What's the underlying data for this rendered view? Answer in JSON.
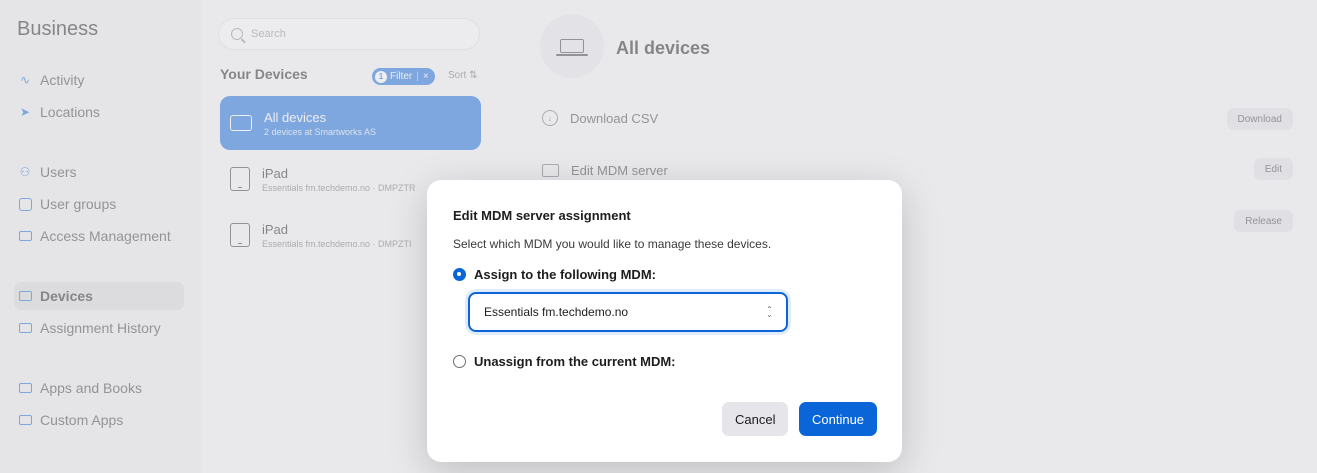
{
  "sidebar": {
    "brand": "Business",
    "items": [
      {
        "label": "Activity"
      },
      {
        "label": "Locations"
      },
      {
        "label": "Users"
      },
      {
        "label": "User groups"
      },
      {
        "label": "Access Management"
      },
      {
        "label": "Devices",
        "selected": true
      },
      {
        "label": "Assignment History"
      },
      {
        "label": "Apps and Books"
      },
      {
        "label": "Custom Apps"
      }
    ]
  },
  "list": {
    "search_placeholder": "Search",
    "heading": "Your Devices",
    "filter_count": "1",
    "filter_label": "Filter",
    "filter_clear": "×",
    "sort_label": "Sort ⇅",
    "devices": [
      {
        "title": "All devices",
        "subtitle": "2 devices at Smartworks AS",
        "active": true
      },
      {
        "title": "iPad",
        "subtitle": "Essentials fm.techdemo.no · DMPZTR"
      },
      {
        "title": "iPad",
        "subtitle": "Essentials fm.techdemo.no · DMPZTI"
      }
    ]
  },
  "detail": {
    "title": "All devices",
    "rows": [
      {
        "label": "Download CSV",
        "action": "Download"
      },
      {
        "label": "Edit MDM server",
        "action": "Edit"
      },
      {
        "label": "",
        "action": "Release"
      }
    ]
  },
  "modal": {
    "title": "Edit MDM server assignment",
    "description": "Select which MDM you would like to manage these devices.",
    "option_assign": "Assign to the following MDM:",
    "option_unassign": "Unassign from the current MDM:",
    "selected_mdm": "Essentials fm.techdemo.no",
    "cancel_label": "Cancel",
    "continue_label": "Continue"
  },
  "colors": {
    "accent": "#0a66d8"
  }
}
